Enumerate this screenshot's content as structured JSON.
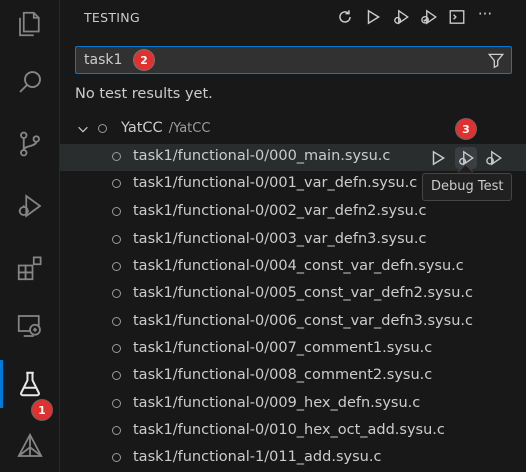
{
  "activity_bar": {
    "items": [
      {
        "name": "explorer-icon"
      },
      {
        "name": "search-icon"
      },
      {
        "name": "source-control-icon"
      },
      {
        "name": "run-debug-icon"
      },
      {
        "name": "extensions-icon"
      },
      {
        "name": "remote-explorer-icon"
      },
      {
        "name": "testing-icon"
      },
      {
        "name": "extension-logo-icon"
      }
    ],
    "badge_1": "1"
  },
  "sidebar": {
    "title": "TESTING",
    "actions": [
      "refresh-icon",
      "run-all-icon",
      "debug-all-icon",
      "coverage-icon",
      "terminal-icon",
      "more-icon"
    ],
    "more_label": "···"
  },
  "filter": {
    "value": "task1",
    "badge": "2"
  },
  "message": "No test results yet.",
  "tree": {
    "root": {
      "label": "YatCC",
      "sublabel": "/YatCC"
    },
    "items": [
      "task1/functional-0/000_main.sysu.c",
      "task1/functional-0/001_var_defn.sysu.c",
      "task1/functional-0/002_var_defn2.sysu.c",
      "task1/functional-0/003_var_defn3.sysu.c",
      "task1/functional-0/004_const_var_defn.sysu.c",
      "task1/functional-0/005_const_var_defn2.sysu.c",
      "task1/functional-0/006_const_var_defn3.sysu.c",
      "task1/functional-0/007_comment1.sysu.c",
      "task1/functional-0/008_comment2.sysu.c",
      "task1/functional-0/009_hex_defn.sysu.c",
      "task1/functional-0/010_hex_oct_add.sysu.c",
      "task1/functional-1/011_add.sysu.c"
    ]
  },
  "tooltip": {
    "text": "Debug Test",
    "badge": "3"
  },
  "colors": {
    "accent": "#0078d4",
    "badge": "#e03131",
    "background": "#181818"
  }
}
